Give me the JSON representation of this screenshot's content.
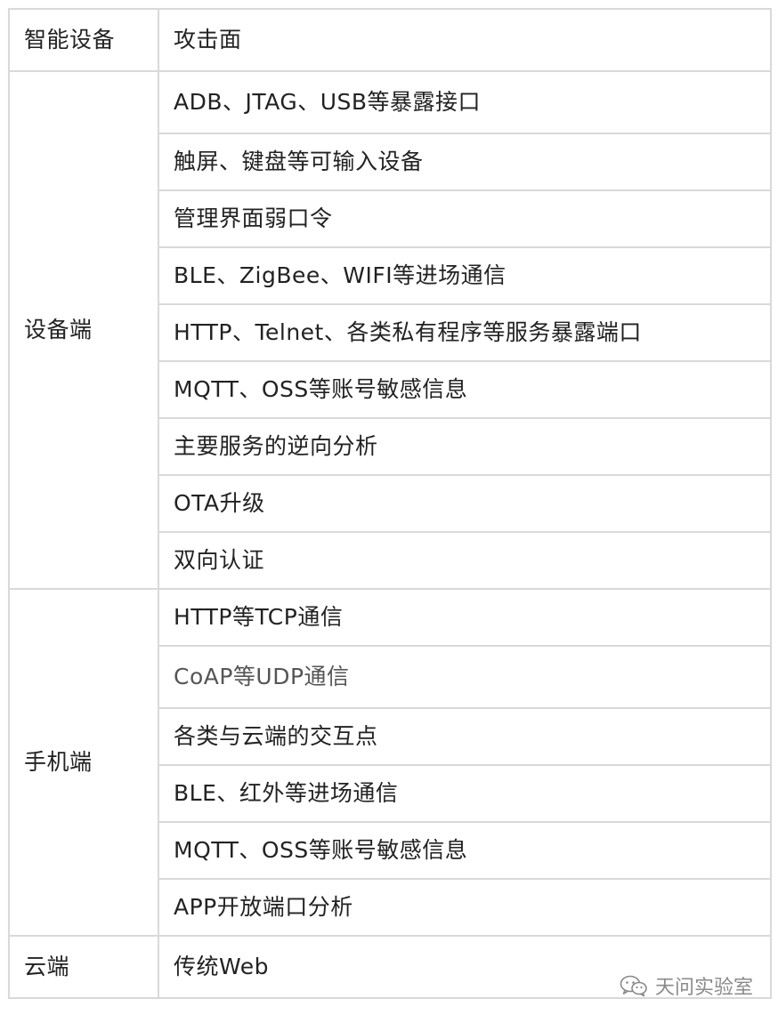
{
  "table": {
    "header": {
      "col1": "智能设备",
      "col2": "攻击面"
    },
    "groups": [
      {
        "category": "设备端",
        "items": [
          "ADB、JTAG、USB等暴露接口",
          "触屏、键盘等可输入设备",
          "管理界面弱口令",
          "BLE、ZigBee、WIFI等进场通信",
          "HTTP、Telnet、各类私有程序等服务暴露端口",
          "MQTT、OSS等账号敏感信息",
          "主要服务的逆向分析",
          "OTA升级",
          "双向认证"
        ]
      },
      {
        "category": "手机端",
        "items": [
          "HTTP等TCP通信",
          "CoAP等UDP通信",
          "各类与云端的交互点",
          "BLE、红外等进场通信",
          "MQTT、OSS等账号敏感信息",
          "APP开放端口分析"
        ]
      },
      {
        "category": "云端",
        "items": [
          "传统Web"
        ]
      }
    ]
  },
  "watermark": {
    "text": "天问实验室",
    "icon": "wechat-icon",
    "color": "#8a8a8a"
  },
  "colors": {
    "border": "#d9d9d9",
    "text": "#222222",
    "muted_text": "#555555"
  }
}
